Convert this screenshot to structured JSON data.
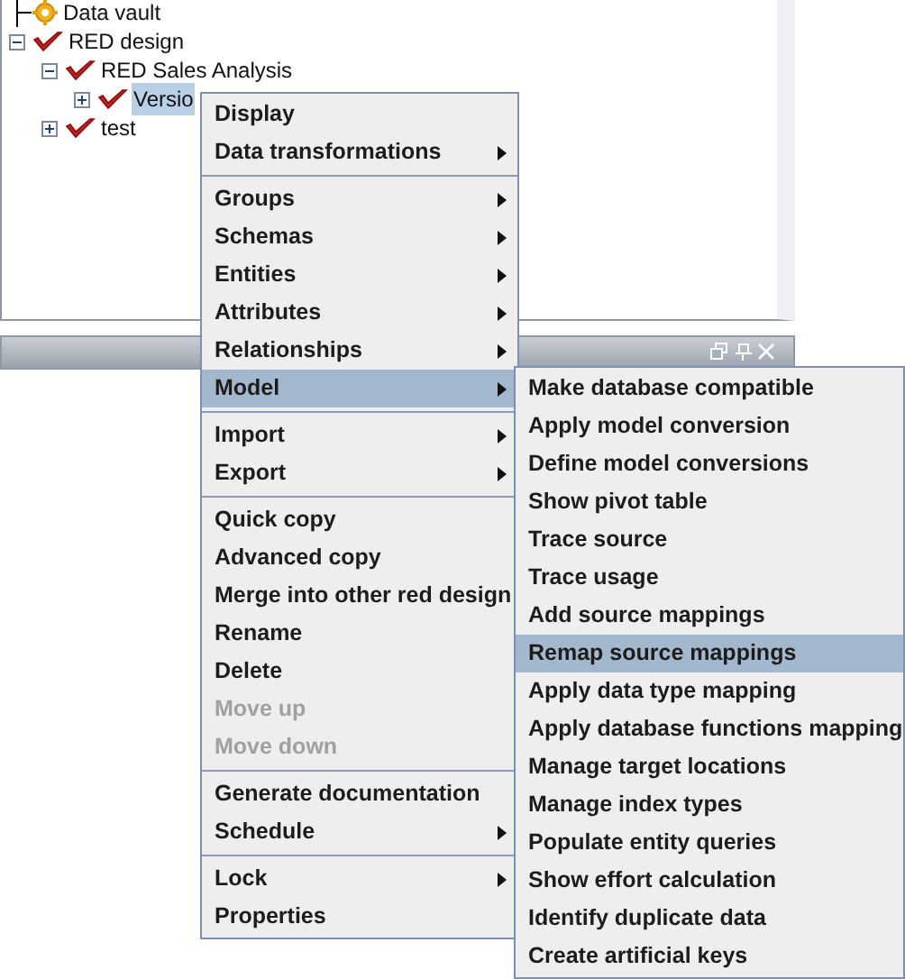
{
  "tree": [
    {
      "label": "Data vault",
      "kind": "vault",
      "selected": false
    },
    {
      "label": "RED design",
      "kind": "design",
      "expanded": true,
      "selected": false,
      "children": [
        {
          "label": "RED Sales Analysis",
          "kind": "design",
          "expanded": true,
          "selected": false,
          "children": [
            {
              "label": "Versio",
              "kind": "design",
              "expanded": false,
              "selected": true
            }
          ]
        },
        {
          "label": "test",
          "kind": "design",
          "expanded": false,
          "selected": false
        }
      ]
    }
  ],
  "context_menu": [
    [
      {
        "label": "Display",
        "submenu": false,
        "disabled": false,
        "selected": false
      },
      {
        "label": "Data transformations",
        "submenu": true,
        "disabled": false,
        "selected": false
      }
    ],
    [
      {
        "label": "Groups",
        "submenu": true,
        "disabled": false,
        "selected": false
      },
      {
        "label": "Schemas",
        "submenu": true,
        "disabled": false,
        "selected": false
      },
      {
        "label": "Entities",
        "submenu": true,
        "disabled": false,
        "selected": false
      },
      {
        "label": "Attributes",
        "submenu": true,
        "disabled": false,
        "selected": false
      },
      {
        "label": "Relationships",
        "submenu": true,
        "disabled": false,
        "selected": false
      },
      {
        "label": "Model",
        "submenu": true,
        "disabled": false,
        "selected": true
      }
    ],
    [
      {
        "label": "Import",
        "submenu": true,
        "disabled": false,
        "selected": false
      },
      {
        "label": "Export",
        "submenu": true,
        "disabled": false,
        "selected": false
      }
    ],
    [
      {
        "label": "Quick copy",
        "submenu": false,
        "disabled": false,
        "selected": false
      },
      {
        "label": "Advanced copy",
        "submenu": false,
        "disabled": false,
        "selected": false
      },
      {
        "label": "Merge into other red design",
        "submenu": false,
        "disabled": false,
        "selected": false
      },
      {
        "label": "Rename",
        "submenu": false,
        "disabled": false,
        "selected": false
      },
      {
        "label": "Delete",
        "submenu": false,
        "disabled": false,
        "selected": false
      },
      {
        "label": "Move up",
        "submenu": false,
        "disabled": true,
        "selected": false
      },
      {
        "label": "Move down",
        "submenu": false,
        "disabled": true,
        "selected": false
      }
    ],
    [
      {
        "label": "Generate documentation",
        "submenu": false,
        "disabled": false,
        "selected": false
      },
      {
        "label": "Schedule",
        "submenu": true,
        "disabled": false,
        "selected": false
      }
    ],
    [
      {
        "label": "Lock",
        "submenu": true,
        "disabled": false,
        "selected": false
      },
      {
        "label": "Properties",
        "submenu": false,
        "disabled": false,
        "selected": false
      }
    ]
  ],
  "model_submenu": [
    {
      "label": "Make database compatible",
      "selected": false
    },
    {
      "label": "Apply model conversion",
      "selected": false
    },
    {
      "label": "Define model conversions",
      "selected": false
    },
    {
      "label": "Show pivot table",
      "selected": false
    },
    {
      "label": "Trace source",
      "selected": false
    },
    {
      "label": "Trace usage",
      "selected": false
    },
    {
      "label": "Add source mappings",
      "selected": false
    },
    {
      "label": "Remap source mappings",
      "selected": true
    },
    {
      "label": "Apply data type mapping",
      "selected": false
    },
    {
      "label": "Apply database functions mapping",
      "selected": false
    },
    {
      "label": "Manage target locations",
      "selected": false
    },
    {
      "label": "Manage index types",
      "selected": false
    },
    {
      "label": "Populate entity queries",
      "selected": false
    },
    {
      "label": "Show effort calculation",
      "selected": false
    },
    {
      "label": "Identify duplicate data",
      "selected": false
    },
    {
      "label": "Create artificial keys",
      "selected": false
    }
  ]
}
